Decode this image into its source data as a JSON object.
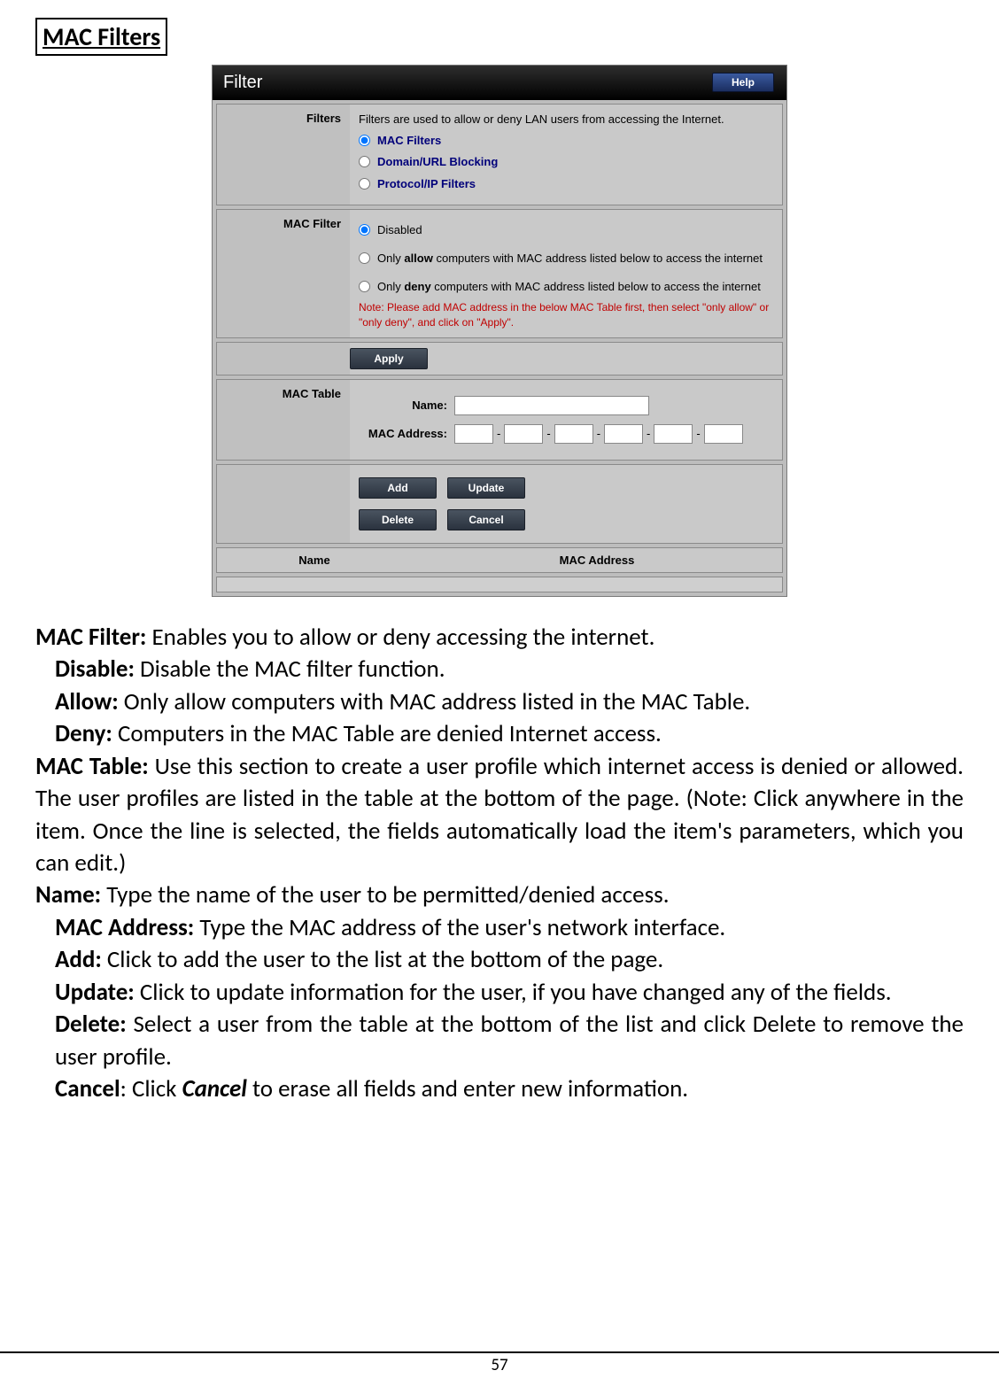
{
  "heading": "MAC Filters",
  "router": {
    "title": "Filter",
    "help": "Help",
    "filters": {
      "label": "Filters",
      "desc": "Filters are used to allow or deny LAN users from accessing the Internet.",
      "opt_mac": "MAC Filters",
      "opt_domain": "Domain/URL Blocking",
      "opt_protocol": "Protocol/IP Filters"
    },
    "mac_filter": {
      "label": "MAC Filter",
      "opt_disabled": "Disabled",
      "opt_allow_pre": "Only ",
      "opt_allow_bold": "allow",
      "opt_allow_post": " computers with MAC address listed below to access the internet",
      "opt_deny_pre": "Only ",
      "opt_deny_bold": "deny",
      "opt_deny_post": " computers with MAC address listed below to access the internet",
      "note": "Note: Please add MAC address in the below MAC Table first, then select \"only allow\" or \"only deny\", and click on \"Apply\"."
    },
    "apply": "Apply",
    "mac_table": {
      "label": "MAC Table",
      "name_label": "Name:",
      "mac_label": "MAC Address:",
      "dash": "-"
    },
    "buttons": {
      "add": "Add",
      "update": "Update",
      "delete": "Delete",
      "cancel": "Cancel"
    },
    "columns": {
      "name": "Name",
      "mac": "MAC Address"
    }
  },
  "doc": {
    "mac_filter_b": "MAC Filter:",
    "mac_filter_t": " Enables you to allow or deny accessing the internet.",
    "disable_b": "Disable:",
    "disable_t": " Disable the MAC filter function.",
    "allow_b": "Allow:",
    "allow_t": " Only allow computers with MAC address listed in the MAC Table.",
    "deny_b": "Deny:",
    "deny_t": " Computers in the MAC Table are denied Internet access.",
    "mac_table_b": "MAC Table:",
    "mac_table_t": " Use this section to create a user profile which internet access is denied or allowed.  The user profiles are listed in the table at the bottom of the page.   (Note: Click anywhere in the item. Once the line is selected, the fields automatically load the item's parameters, which you can edit.)",
    "name_b": "Name:",
    "name_t": " Type the name of the user to be permitted/denied access.",
    "macaddr_b": "MAC Address:",
    "macaddr_t": " Type the MAC address of the user's network interface.",
    "add_b": "Add:",
    "add_t": " Click to add the user to the list at the bottom of the page.",
    "update_b": "Update:",
    "update_t": " Click to update information for the user, if you have changed any of the fields.",
    "delete_b": "Delete:",
    "delete_t": " Select a user from the table at the bottom of the list and click Delete to remove the user profile.",
    "cancel_b": "Cancel",
    "cancel_mid": ": Click ",
    "cancel_i": "Cancel",
    "cancel_t": " to erase all fields and enter new information."
  },
  "page_number": "57"
}
